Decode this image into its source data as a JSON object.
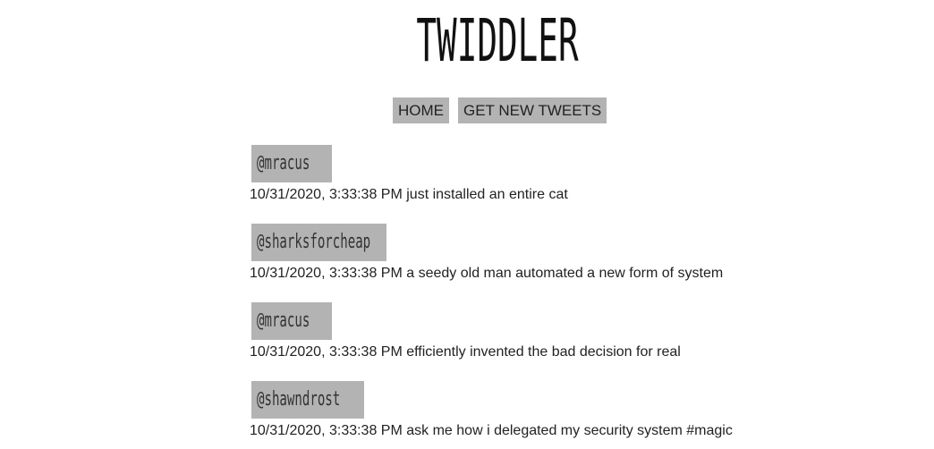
{
  "header": {
    "title": "TWIDDLER"
  },
  "nav": {
    "home_label": "HOME",
    "new_tweets_label": "GET NEW TWEETS"
  },
  "tweets": [
    {
      "user": "@mracus",
      "timestamp": "10/31/2020, 3:33:38 PM",
      "message": "just installed an entire cat"
    },
    {
      "user": "@sharksforcheap",
      "timestamp": "10/31/2020, 3:33:38 PM",
      "message": "a seedy old man automated a new form of system"
    },
    {
      "user": "@mracus",
      "timestamp": "10/31/2020, 3:33:38 PM",
      "message": "efficiently invented the bad decision for real"
    },
    {
      "user": "@shawndrost",
      "timestamp": "10/31/2020, 3:33:38 PM",
      "message": "ask me how i delegated my security system #magic"
    }
  ],
  "colors": {
    "button_bg": "#b3b3b3",
    "text": "#222222",
    "background": "#ffffff"
  }
}
